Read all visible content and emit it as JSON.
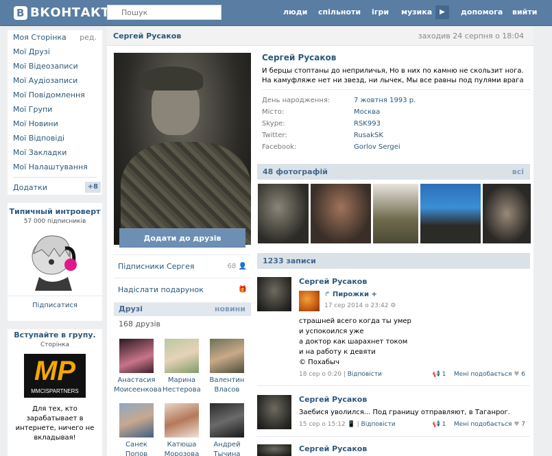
{
  "header": {
    "logo": "ВКОНТАКТЕ",
    "search_placeholder": "Пошук",
    "nav": [
      "люди",
      "спільноти",
      "ігри",
      "музика",
      "допомога",
      "вийти"
    ]
  },
  "left_menu": {
    "items": [
      "Моя Сторінка",
      "Мої Друзі",
      "Мої Відеозаписи",
      "Мої Аудіозаписи",
      "Мої Повідомлення",
      "Мої Групи",
      "Мої Новини",
      "Мої Відповіді",
      "Мої Закладки",
      "Мої Налаштування"
    ],
    "edit": "ред.",
    "apps": "Додатки",
    "apps_badge": "+8"
  },
  "promo1": {
    "title": "Типичный интроверт",
    "subscribers": "57 000 підписників",
    "button": "Підписатися"
  },
  "promo2": {
    "title": "Вступайте в групу.",
    "sub": "Сторінка",
    "logo_text": "MP",
    "logo_sub": "MMCISPARTNERS",
    "desc": "Для тех, кто зарабатывает в интернете, ничего не вкладывая!"
  },
  "profile": {
    "name": "Сергей Русаков",
    "last_seen": "заходив 24 серпня о 18:04",
    "status": "И берцы стоптаны до неприличья, Но в них по камню не скользит нога.\nНа камуфляже нет ни звезд, ни лычек, Мы все равны под пулями врага",
    "info": [
      {
        "k": "День народження:",
        "v": "7 жовтня 1993 р."
      },
      {
        "k": "Місто:",
        "v": "Москва"
      },
      {
        "k": "Skype:",
        "v": "RSK993"
      },
      {
        "k": "Twitter:",
        "v": "RusakSK"
      },
      {
        "k": "Facebook:",
        "v": "Gorlov Sergei"
      }
    ],
    "add_friend": "Додати до друзів",
    "subscribers_label": "Підписники Сергея",
    "subscribers_count": "68",
    "gift_label": "Надіслати подарунок"
  },
  "friends": {
    "title": "Друзі",
    "new_label": "новини",
    "count": "168 друзів",
    "list": [
      {
        "first": "Анастасия",
        "last": "Моисеенкова"
      },
      {
        "first": "Марина",
        "last": "Нестерова"
      },
      {
        "first": "Валентин",
        "last": "Власов"
      },
      {
        "first": "Санек",
        "last": "Попов"
      },
      {
        "first": "Катюша",
        "last": "Морозова"
      },
      {
        "first": "Андрей",
        "last": "Тычина"
      }
    ]
  },
  "photos": {
    "title": "48 фотографій",
    "all": "всі"
  },
  "wall": {
    "title": "1233 записи",
    "posts": [
      {
        "author": "Сергей Русаков",
        "repost_from": "Пирожки +",
        "repost_date": "17 сер 2014 о 23:42",
        "text": "страшней всего когда ты умер\nи успокоился уже\nа доктор как шарахнет током\nи на работу к девяти\n© Похабыч",
        "date": "18 сер о 0:20",
        "reply": "Відповісти",
        "reposts": "1",
        "likes_label": "Мені подобається",
        "likes": "6"
      },
      {
        "author": "Сергей Русаков",
        "text": "Заебися уволился... Под границу отправляют, в Таганрог.",
        "date": "15 сер о 15:12",
        "reply": "Відповісти",
        "reposts": "1",
        "likes_label": "Мені подобається",
        "likes": "7"
      },
      {
        "author": "Сергей Русаков"
      }
    ]
  }
}
